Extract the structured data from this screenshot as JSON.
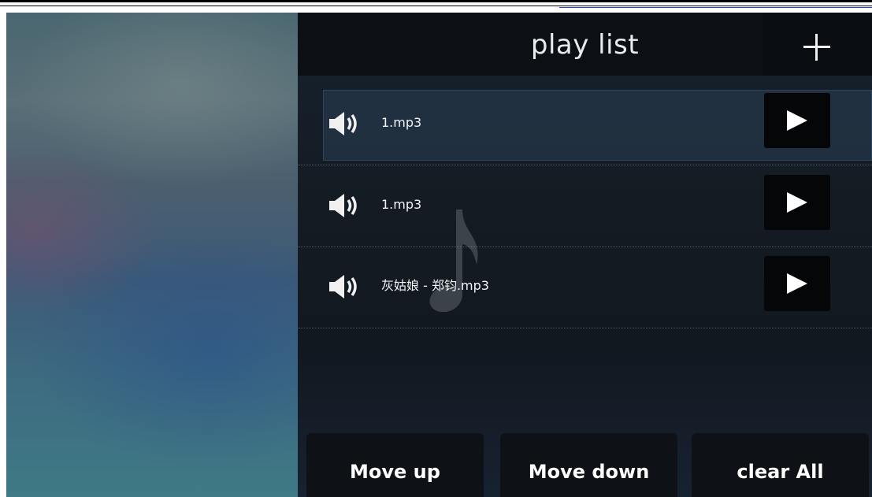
{
  "header": {
    "title": "play list",
    "add_icon": "plus-icon"
  },
  "playlist": {
    "items": [
      {
        "label": "1.mp3",
        "icon": "speaker-icon",
        "action_icon": "play-icon",
        "selected": true
      },
      {
        "label": "1.mp3",
        "icon": "speaker-icon",
        "action_icon": "play-icon",
        "selected": false
      },
      {
        "label": "灰姑娘 - 郑钧.mp3",
        "icon": "speaker-icon",
        "action_icon": "play-icon",
        "selected": false
      }
    ]
  },
  "background_icon": "music-note-icon",
  "footer": {
    "move_up_label": "Move up",
    "move_down_label": "Move down",
    "clear_all_label": "clear All"
  },
  "colors": {
    "header_bg": "#0c1015",
    "button_bg": "#0e1216",
    "play_button_bg": "#050607",
    "text": "#ffffff"
  }
}
